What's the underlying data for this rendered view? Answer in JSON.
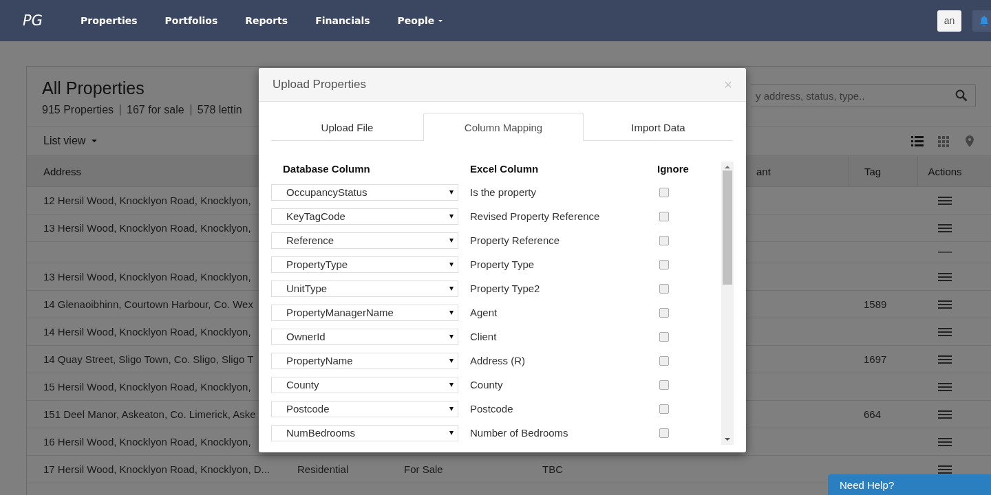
{
  "navbar": {
    "logo": "PG",
    "items": [
      {
        "label": "Properties",
        "dropdown": false
      },
      {
        "label": "Portfolios",
        "dropdown": false
      },
      {
        "label": "Reports",
        "dropdown": false
      },
      {
        "label": "Financials",
        "dropdown": false
      },
      {
        "label": "People",
        "dropdown": true
      }
    ],
    "user_button": "an"
  },
  "page": {
    "title": "All Properties",
    "stats": [
      "915 Properties",
      "167 for sale",
      "578 lettin"
    ],
    "search": {
      "placeholder": "y address, status, type.."
    },
    "view_menu": "List view",
    "views": [
      {
        "kind": "list",
        "selected": true
      },
      {
        "kind": "grid",
        "selected": false
      },
      {
        "kind": "map",
        "selected": false
      }
    ],
    "table": {
      "columns": {
        "address": "Address",
        "column_5": "ant",
        "tag": "Tag",
        "actions": "Actions"
      },
      "rows": [
        {
          "address": "12 Hersil Wood, Knocklyon Road, Knocklyon,"
        },
        {
          "address": "13 Hersil Wood, Knocklyon Road, Knocklyon,"
        },
        {
          "kind": "partial"
        },
        {
          "address": "13 Hersil Wood, Knocklyon Road, Knocklyon,"
        },
        {
          "address": "14 Glenaoibhinn, Courtown Harbour, Co. Wex",
          "tag": "1589"
        },
        {
          "address": "14 Hersil Wood, Knocklyon Road, Knocklyon,"
        },
        {
          "address": "14 Quay Street, Sligo Town, Co. Sligo, Sligo T",
          "tag": "1697"
        },
        {
          "address": "15 Hersil Wood, Knocklyon Road, Knocklyon,"
        },
        {
          "address": "151 Deel Manor, Askeaton, Co. Limerick, Aske",
          "tag": "664"
        },
        {
          "address": "16 Hersil Wood, Knocklyon Road, Knocklyon,"
        },
        {
          "address": "17 Hersil Wood, Knocklyon Road, Knocklyon, D...",
          "column_2": "Residential",
          "column_3": "For Sale",
          "column_4": "TBC"
        }
      ]
    }
  },
  "modal": {
    "title": "Upload Properties",
    "close": "×",
    "tabs": [
      {
        "label": "Upload File",
        "selected": false
      },
      {
        "label": "Column Mapping",
        "selected": true
      },
      {
        "label": "Import Data",
        "selected": false
      }
    ],
    "mapping": {
      "headers": [
        "Database Column",
        "Excel Column",
        "Ignore"
      ],
      "rows": [
        {
          "database_column": "OccupancyStatus",
          "excel_column": "Is the property",
          "ignored": false
        },
        {
          "database_column": "KeyTagCode",
          "excel_column": "Revised Property Reference",
          "ignored": false
        },
        {
          "database_column": "Reference",
          "excel_column": "Property Reference",
          "ignored": false
        },
        {
          "database_column": "PropertyType",
          "excel_column": "Property Type",
          "ignored": false
        },
        {
          "database_column": "UnitType",
          "excel_column": "Property Type2",
          "ignored": false
        },
        {
          "database_column": "PropertyManagerName",
          "excel_column": "Agent",
          "ignored": false
        },
        {
          "database_column": "OwnerId",
          "excel_column": "Client",
          "ignored": false
        },
        {
          "database_column": "PropertyName",
          "excel_column": "Address (R)",
          "ignored": false
        },
        {
          "database_column": "County",
          "excel_column": "County",
          "ignored": false
        },
        {
          "database_column": "Postcode",
          "excel_column": "Postcode",
          "ignored": false
        },
        {
          "database_column": "NumBedrooms",
          "excel_column": "Number of Bedrooms",
          "ignored": false
        }
      ]
    }
  },
  "help_button": "Need Help?"
}
